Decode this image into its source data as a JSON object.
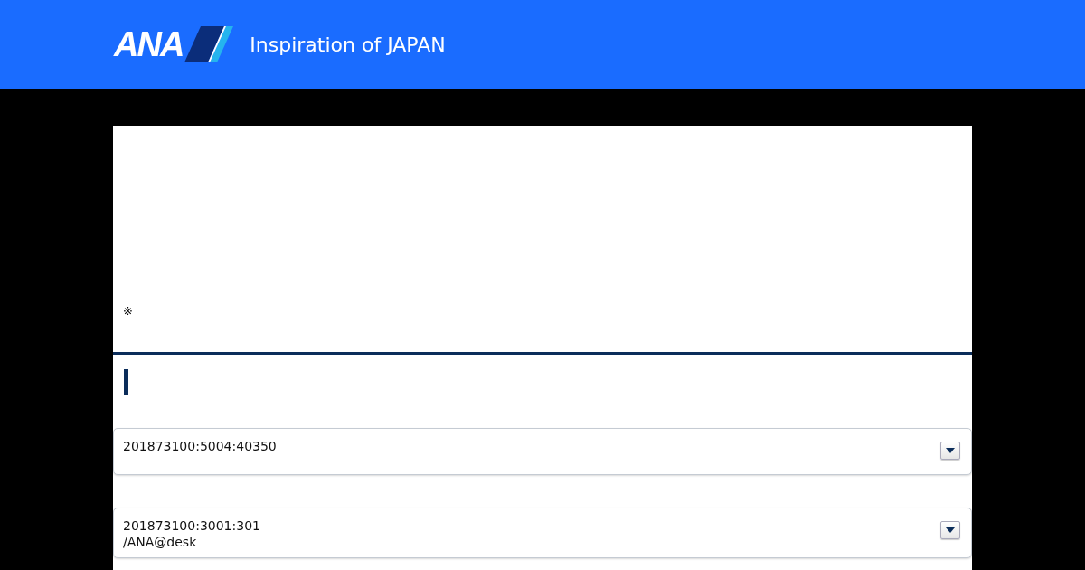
{
  "header": {
    "logo_text": "ANA",
    "tagline": "Inspiration of JAPAN"
  },
  "notice": {
    "mark": "※"
  },
  "dropdowns": [
    {
      "lines": [
        "201873100:5004:40350"
      ]
    },
    {
      "lines": [
        "201873100:3001:301",
        "/ANA@desk"
      ]
    }
  ]
}
